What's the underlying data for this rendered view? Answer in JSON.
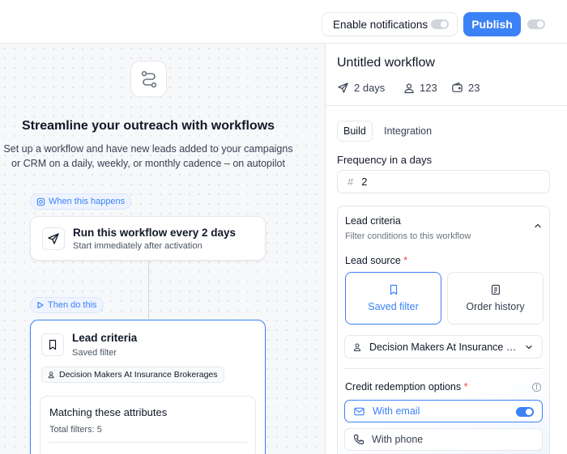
{
  "header": {
    "notifications_label": "Enable notifications",
    "publish_label": "Publish"
  },
  "canvas": {
    "title": "Streamline your outreach with workflows",
    "description_line1": "Set up a workflow and have new leads added to your campaigns",
    "description_line2": "or CRM on a daily, weekly, or monthly cadence – on autopilot",
    "trigger_pill": "When this happens",
    "trigger_card": {
      "title": "Run this workflow every 2 days",
      "subtitle": "Start immediately after activation"
    },
    "action_pill": "Then do this",
    "lead_card": {
      "title": "Lead criteria",
      "subtitle": "Saved filter",
      "chip": "Decision Makers At Insurance Brokerages",
      "attributes_title": "Matching these attributes",
      "attributes_sub": "Total filters: 5"
    }
  },
  "panel": {
    "title": "Untitled workflow",
    "stats": {
      "days": "2 days",
      "users": "123",
      "credits": "23"
    },
    "tabs": [
      {
        "label": "Build",
        "active": true
      },
      {
        "label": "Integration",
        "active": false
      }
    ],
    "frequency": {
      "label": "Frequency in a days",
      "prefix": "#",
      "value": "2"
    },
    "lead_criteria": {
      "title": "Lead criteria",
      "subtitle": "Filter conditions to this workflow",
      "source_label": "Lead source",
      "required_mark": "*",
      "sources": [
        {
          "label": "Saved filter",
          "selected": true
        },
        {
          "label": "Order history",
          "selected": false
        }
      ],
      "selected_filter": "Decision Makers At Insurance Brokerages",
      "credit_label": "Credit redemption options",
      "credit_options": [
        {
          "label": "With email",
          "enabled": true
        },
        {
          "label": "With phone",
          "enabled": false
        }
      ]
    }
  },
  "colors": {
    "accent": "#3b82f6",
    "required": "#ef4444"
  }
}
